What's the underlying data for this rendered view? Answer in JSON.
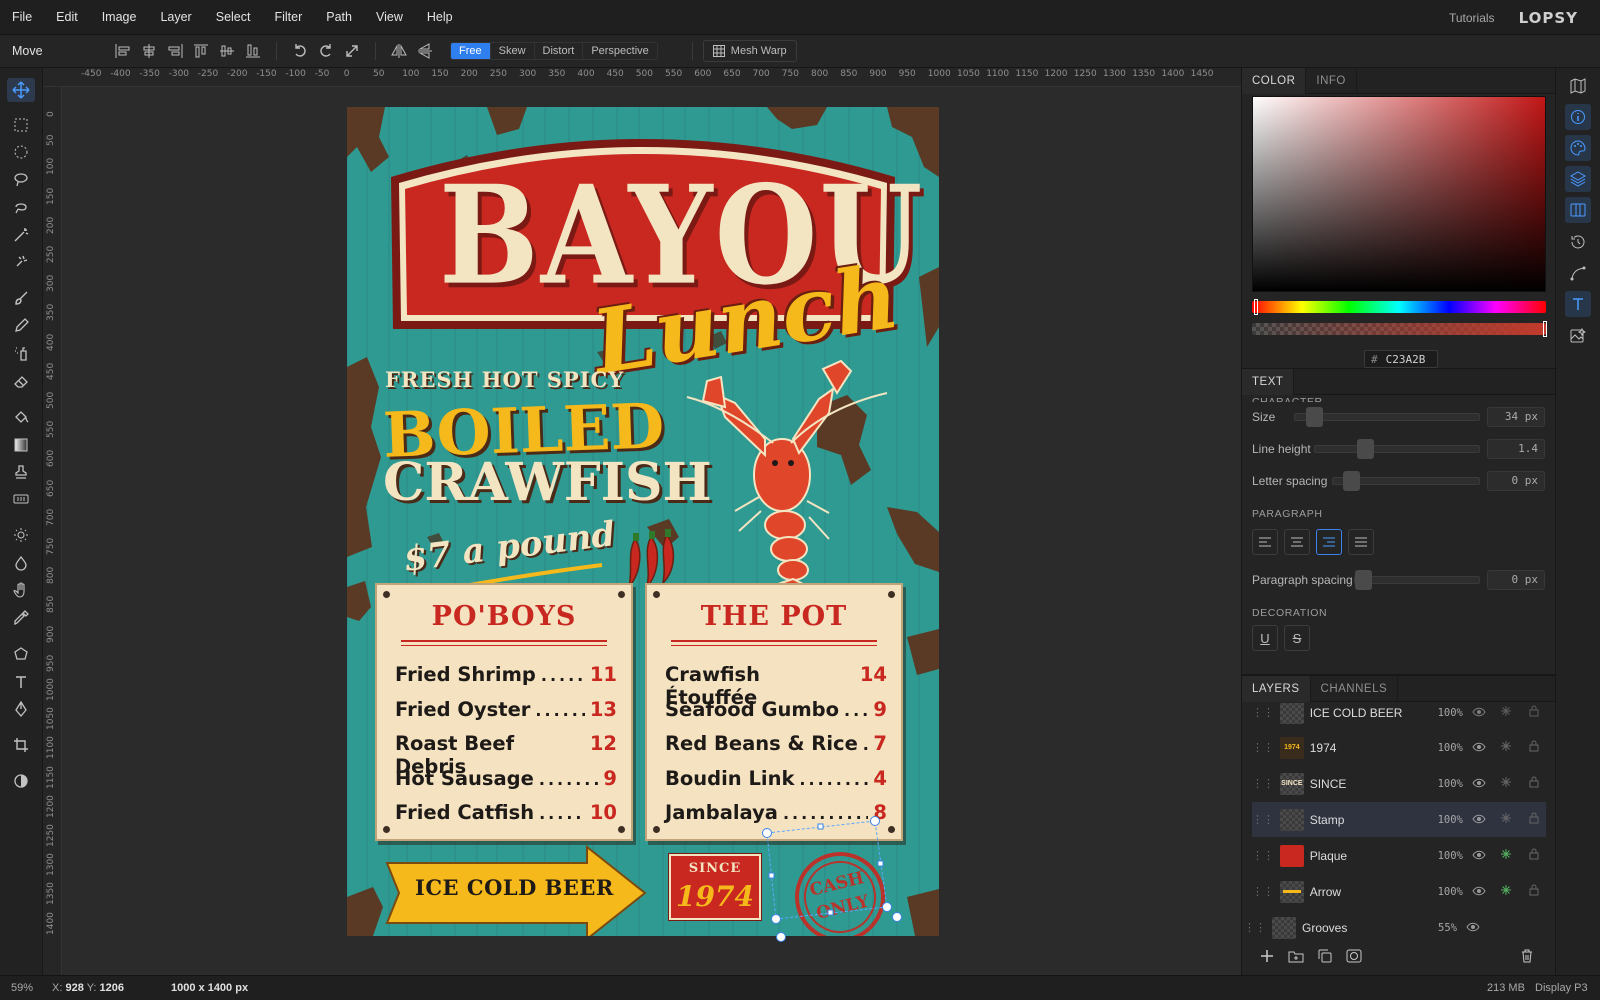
{
  "menubar": {
    "items": [
      "File",
      "Edit",
      "Image",
      "Layer",
      "Select",
      "Filter",
      "Path",
      "View",
      "Help"
    ],
    "tutorials": "Tutorials",
    "logo": "LOPSY"
  },
  "toolbar": {
    "tool_name": "Move",
    "modes": [
      "Free",
      "Skew",
      "Distort",
      "Perspective"
    ],
    "active_mode": "Free",
    "mesh_warp": "Mesh Warp"
  },
  "rulers": {
    "top": [
      "-450",
      "-400",
      "-350",
      "-300",
      "-250",
      "-200",
      "-150",
      "-100",
      "-50",
      "0",
      "50",
      "100",
      "150",
      "200",
      "250",
      "300",
      "350",
      "400",
      "450",
      "500",
      "550",
      "600",
      "650",
      "700",
      "750",
      "800",
      "850",
      "900",
      "950",
      "1000",
      "1050",
      "1100",
      "1150",
      "1200",
      "1250",
      "1300",
      "1350",
      "1400",
      "1450"
    ],
    "left": [
      "0",
      "50",
      "100",
      "150",
      "200",
      "250",
      "300",
      "350",
      "400",
      "450",
      "500",
      "550",
      "600",
      "650",
      "700",
      "750",
      "800",
      "850",
      "900",
      "950",
      "1000",
      "1050",
      "1100",
      "1150",
      "1200",
      "1250",
      "1300",
      "1350",
      "1400"
    ]
  },
  "poster": {
    "title": "BAYOU",
    "subtitle": "Lunch",
    "tagline": "FRESH HOT SPICY",
    "headline1": "BOILED",
    "headline2": "CRAWFISH",
    "price": "$7 a pound",
    "boards": [
      {
        "heading": "PO'BOYS",
        "items": [
          {
            "name": "Fried Shrimp",
            "dots": "........",
            "price": "11"
          },
          {
            "name": "Fried Oyster",
            "dots": "........",
            "price": "13"
          },
          {
            "name": "Roast Beef Debris",
            "dots": "...",
            "price": "12"
          },
          {
            "name": "Hot Sausage",
            "dots": "........",
            "price": "9"
          },
          {
            "name": "Fried Catfish",
            "dots": ".......",
            "price": "10"
          }
        ]
      },
      {
        "heading": "THE POT",
        "items": [
          {
            "name": "Crawfish Étouffée",
            "dots": "....",
            "price": "14"
          },
          {
            "name": "Seafood Gumbo",
            "dots": "......",
            "price": "9"
          },
          {
            "name": "Red Beans & Rice",
            "dots": "....",
            "price": "7"
          },
          {
            "name": "Boudin Link",
            "dots": "..........",
            "price": "4"
          },
          {
            "name": "Jambalaya",
            "dots": "..........",
            "price": "8"
          }
        ]
      }
    ],
    "beer": "ICE COLD BEER",
    "since": "SINCE",
    "year": "1974",
    "stamp_line1": "CASH",
    "stamp_line2": "ONLY"
  },
  "color_panel": {
    "tabs": [
      "COLOR",
      "INFO"
    ],
    "hex": "C23A2B",
    "hash": "#"
  },
  "text_panel": {
    "tab": "TEXT",
    "section_character": "CHARACTER",
    "size_label": "Size",
    "size_value": "34 px",
    "line_height_label": "Line height",
    "line_height_value": "1.4",
    "letter_spacing_label": "Letter spacing",
    "letter_spacing_value": "0 px",
    "section_paragraph": "PARAGRAPH",
    "paragraph_spacing_label": "Paragraph spacing",
    "paragraph_spacing_value": "0 px",
    "section_decoration": "DECORATION",
    "underline": "U",
    "strike": "S"
  },
  "layers_panel": {
    "tabs": [
      "LAYERS",
      "CHANNELS"
    ],
    "layers": [
      {
        "name": "ICE COLD BEER",
        "opacity": "100%"
      },
      {
        "name": "1974",
        "opacity": "100%"
      },
      {
        "name": "SINCE",
        "opacity": "100%"
      },
      {
        "name": "Stamp",
        "opacity": "100%"
      },
      {
        "name": "Plaque",
        "opacity": "100%"
      },
      {
        "name": "Arrow",
        "opacity": "100%"
      },
      {
        "name": "Grooves",
        "opacity": "55%"
      }
    ],
    "selected": "Stamp"
  },
  "statusbar": {
    "zoom": "59%",
    "x_label": "X:",
    "x_value": "928",
    "y_label": "Y:",
    "y_value": "1206",
    "doc_size": "1000 x 1400 px",
    "memory": "213 MB",
    "color_profile": "Display P3"
  },
  "colors": {
    "accent": "#2f7ff0",
    "poster_red": "#c8281f",
    "poster_teal": "#2f9a92",
    "poster_cream": "#f3e4c2",
    "poster_gold": "#f6b91b"
  }
}
